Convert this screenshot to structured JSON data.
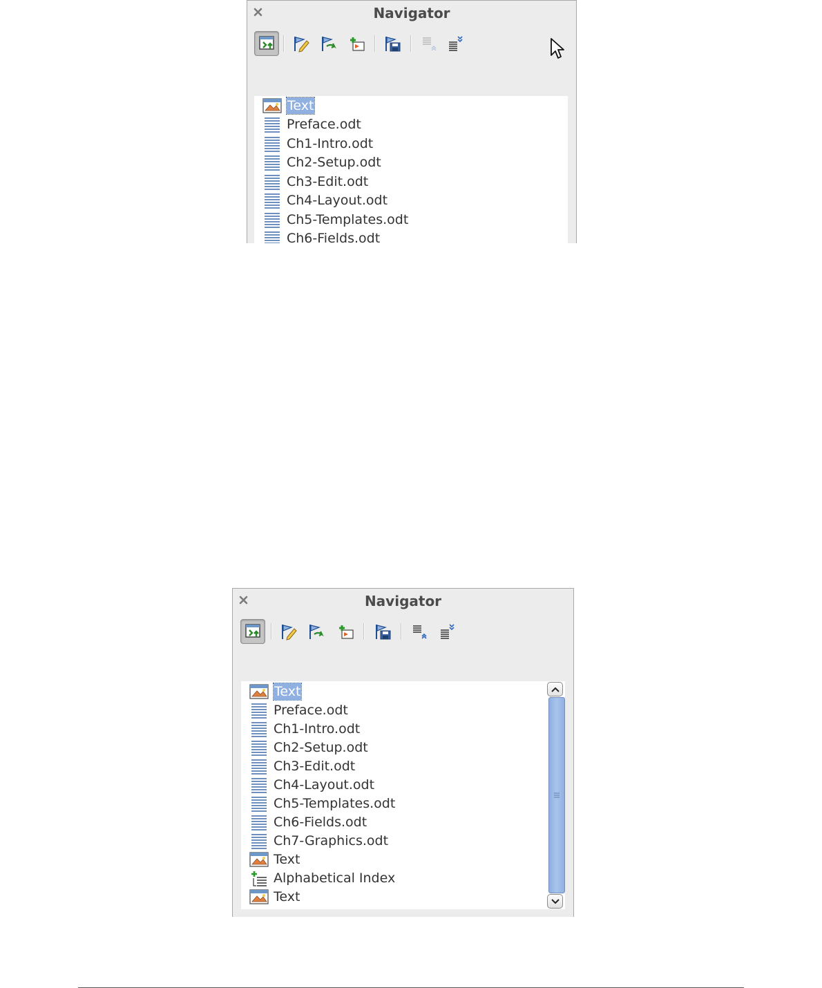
{
  "panels": [
    {
      "title": "Navigator",
      "items": [
        {
          "label": "Text",
          "icon": "picture-icon",
          "selected": true
        },
        {
          "label": "Preface.odt",
          "icon": "document-icon"
        },
        {
          "label": "Ch1-Intro.odt",
          "icon": "document-icon"
        },
        {
          "label": "Ch2-Setup.odt",
          "icon": "document-icon"
        },
        {
          "label": "Ch3-Edit.odt",
          "icon": "document-icon"
        },
        {
          "label": "Ch4-Layout.odt",
          "icon": "document-icon"
        },
        {
          "label": "Ch5-Templates.odt",
          "icon": "document-icon"
        },
        {
          "label": "Ch6-Fields.odt",
          "icon": "document-icon"
        }
      ]
    },
    {
      "title": "Navigator",
      "items": [
        {
          "label": "Text",
          "icon": "picture-icon",
          "selected": true
        },
        {
          "label": "Preface.odt",
          "icon": "document-icon"
        },
        {
          "label": "Ch1-Intro.odt",
          "icon": "document-icon"
        },
        {
          "label": "Ch2-Setup.odt",
          "icon": "document-icon"
        },
        {
          "label": "Ch3-Edit.odt",
          "icon": "document-icon"
        },
        {
          "label": "Ch4-Layout.odt",
          "icon": "document-icon"
        },
        {
          "label": "Ch5-Templates.odt",
          "icon": "document-icon"
        },
        {
          "label": "Ch6-Fields.odt",
          "icon": "document-icon"
        },
        {
          "label": "Ch7-Graphics.odt",
          "icon": "document-icon"
        },
        {
          "label": "Text",
          "icon": "picture-icon"
        },
        {
          "label": "Alphabetical Index",
          "icon": "index-icon"
        },
        {
          "label": "Text",
          "icon": "picture-icon"
        }
      ]
    }
  ],
  "toolbar_icons": [
    "toggle-master-view-icon",
    "edit-icon",
    "update-icon",
    "insert-icon",
    "save-contents-icon",
    "move-up-icon",
    "move-down-icon"
  ],
  "colors": {
    "selection": "#8fb0e0",
    "panel_bg": "#ececec"
  }
}
